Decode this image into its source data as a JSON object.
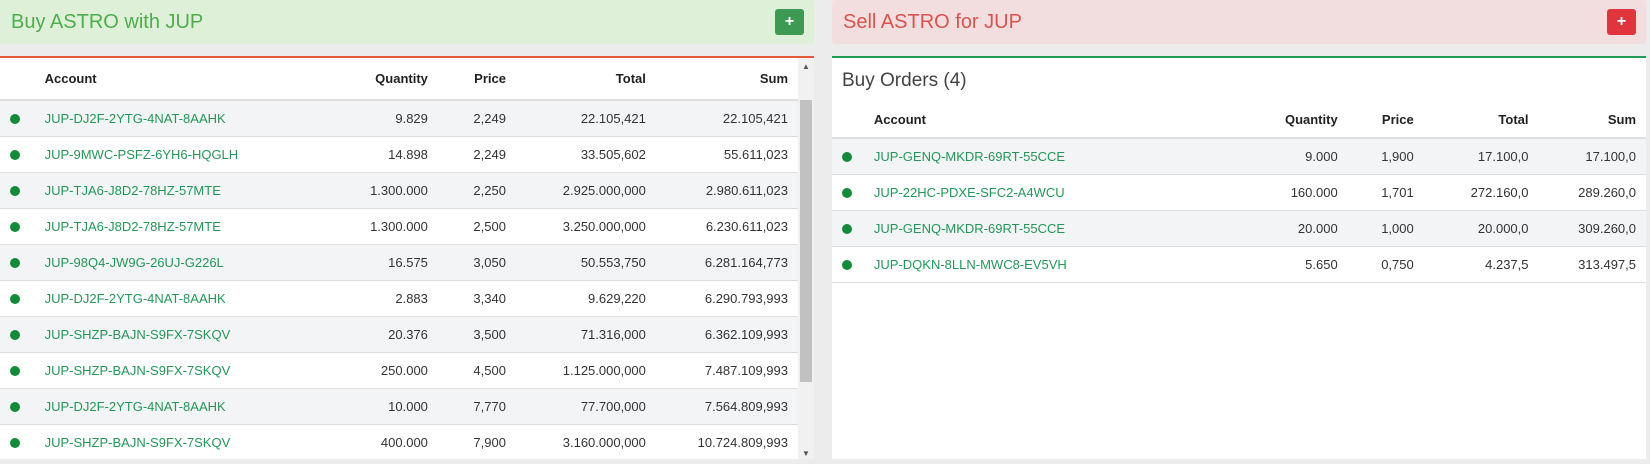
{
  "buy_header": {
    "title": "Buy ASTRO with JUP",
    "button": "+"
  },
  "sell_header": {
    "title": "Sell ASTRO for JUP",
    "button": "+"
  },
  "sell_orders": {
    "columns": {
      "account": "Account",
      "quantity": "Quantity",
      "price": "Price",
      "total": "Total",
      "sum": "Sum"
    },
    "rows": [
      {
        "account": "JUP-DJ2F-2YTG-4NAT-8AAHK",
        "quantity": "9.829",
        "price": "2,249",
        "total": "22.105,421",
        "sum": "22.105,421"
      },
      {
        "account": "JUP-9MWC-PSFZ-6YH6-HQGLH",
        "quantity": "14.898",
        "price": "2,249",
        "total": "33.505,602",
        "sum": "55.611,023"
      },
      {
        "account": "JUP-TJA6-J8D2-78HZ-57MTE",
        "quantity": "1.300.000",
        "price": "2,250",
        "total": "2.925.000,000",
        "sum": "2.980.611,023"
      },
      {
        "account": "JUP-TJA6-J8D2-78HZ-57MTE",
        "quantity": "1.300.000",
        "price": "2,500",
        "total": "3.250.000,000",
        "sum": "6.230.611,023"
      },
      {
        "account": "JUP-98Q4-JW9G-26UJ-G226L",
        "quantity": "16.575",
        "price": "3,050",
        "total": "50.553,750",
        "sum": "6.281.164,773"
      },
      {
        "account": "JUP-DJ2F-2YTG-4NAT-8AAHK",
        "quantity": "2.883",
        "price": "3,340",
        "total": "9.629,220",
        "sum": "6.290.793,993"
      },
      {
        "account": "JUP-SHZP-BAJN-S9FX-7SKQV",
        "quantity": "20.376",
        "price": "3,500",
        "total": "71.316,000",
        "sum": "6.362.109,993"
      },
      {
        "account": "JUP-SHZP-BAJN-S9FX-7SKQV",
        "quantity": "250.000",
        "price": "4,500",
        "total": "1.125.000,000",
        "sum": "7.487.109,993"
      },
      {
        "account": "JUP-DJ2F-2YTG-4NAT-8AAHK",
        "quantity": "10.000",
        "price": "7,770",
        "total": "77.700,000",
        "sum": "7.564.809,993"
      },
      {
        "account": "JUP-SHZP-BAJN-S9FX-7SKQV",
        "quantity": "400.000",
        "price": "7,900",
        "total": "3.160.000,000",
        "sum": "10.724.809,993"
      }
    ]
  },
  "buy_orders": {
    "title": "Buy Orders (4)",
    "columns": {
      "account": "Account",
      "quantity": "Quantity",
      "price": "Price",
      "total": "Total",
      "sum": "Sum"
    },
    "rows": [
      {
        "account": "JUP-GENQ-MKDR-69RT-55CCE",
        "quantity": "9.000",
        "price": "1,900",
        "total": "17.100,0",
        "sum": "17.100,0"
      },
      {
        "account": "JUP-22HC-PDXE-SFC2-A4WCU",
        "quantity": "160.000",
        "price": "1,701",
        "total": "272.160,0",
        "sum": "289.260,0"
      },
      {
        "account": "JUP-GENQ-MKDR-69RT-55CCE",
        "quantity": "20.000",
        "price": "1,000",
        "total": "20.000,0",
        "sum": "309.260,0"
      },
      {
        "account": "JUP-DQKN-8LLN-MWC8-EV5VH",
        "quantity": "5.650",
        "price": "0,750",
        "total": "4.237,5",
        "sum": "313.497,5"
      }
    ]
  },
  "colors": {
    "buy_accent": "#4cae4c",
    "sell_accent": "#d9534f",
    "status_dot": "#138b3a",
    "account_link": "#23975a"
  },
  "icons": {
    "add": "plus-icon",
    "status": "status-dot-icon",
    "scroll_up": "scroll-up-arrow-icon",
    "scroll_down": "scroll-down-arrow-icon"
  }
}
